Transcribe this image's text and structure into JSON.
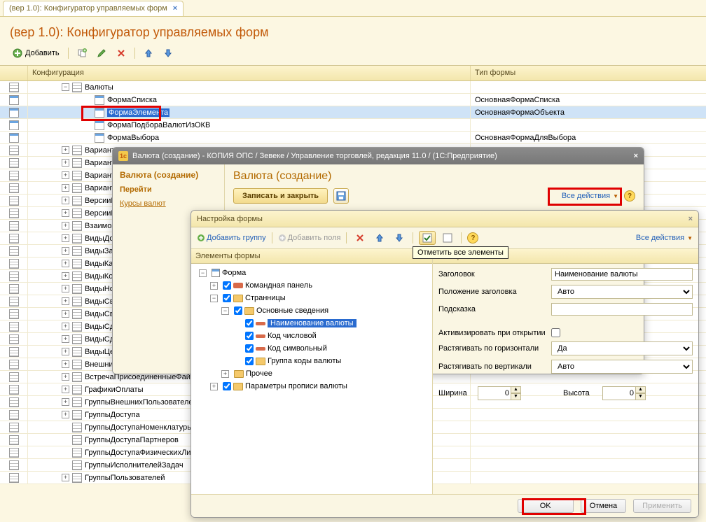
{
  "tab": {
    "title": "(вер 1.0): Конфигуратор управляемых форм"
  },
  "page_title": "(вер 1.0): Конфигуратор управляемых форм",
  "main_toolbar": {
    "add": "Добавить"
  },
  "table": {
    "col_config": "Конфигурация",
    "col_type": "Тип формы",
    "rows": [
      {
        "indent": 48,
        "exp": "−",
        "icon": "grid",
        "label": "Валюты",
        "type": ""
      },
      {
        "indent": 80,
        "icon": "form",
        "label": "ФормаСписка",
        "type": "ОсновнаяФормаСписка"
      },
      {
        "indent": 80,
        "icon": "form",
        "label": "ФормаЭлемента",
        "type": "ОсновнаяФормаОбъекта",
        "selected": true
      },
      {
        "indent": 80,
        "icon": "form",
        "label": "ФормаПодбораВалютИзОКВ",
        "type": ""
      },
      {
        "indent": 80,
        "icon": "form",
        "label": "ФормаВыбора",
        "type": "ОсновнаяФормаДляВыбора"
      },
      {
        "indent": 48,
        "exp": "+",
        "icon": "grid",
        "label": "Варианть",
        "type": ""
      },
      {
        "indent": 48,
        "exp": "+",
        "icon": "grid",
        "label": "Варианть",
        "type": ""
      },
      {
        "indent": 48,
        "exp": "+",
        "icon": "grid",
        "label": "Варианть",
        "type": ""
      },
      {
        "indent": 48,
        "exp": "+",
        "icon": "grid",
        "label": "Варианть",
        "type": ""
      },
      {
        "indent": 48,
        "exp": "+",
        "icon": "grid",
        "label": "ВерсииН",
        "type": ""
      },
      {
        "indent": 48,
        "exp": "+",
        "icon": "grid",
        "label": "ВерсииН",
        "type": ""
      },
      {
        "indent": 48,
        "exp": "+",
        "icon": "grid",
        "label": "Взаимоза",
        "type": ""
      },
      {
        "indent": 48,
        "exp": "+",
        "icon": "grid",
        "label": "ВидыДок",
        "type": ""
      },
      {
        "indent": 48,
        "exp": "+",
        "icon": "grid",
        "label": "ВидыЗап",
        "type": ""
      },
      {
        "indent": 48,
        "exp": "+",
        "icon": "grid",
        "label": "ВидыКарт",
        "type": ""
      },
      {
        "indent": 48,
        "exp": "+",
        "icon": "grid",
        "label": "ВидыКон",
        "type": ""
      },
      {
        "indent": 48,
        "exp": "+",
        "icon": "grid",
        "label": "ВидыНом",
        "type": ""
      },
      {
        "indent": 48,
        "exp": "+",
        "icon": "grid",
        "label": "ВидыСвя",
        "type": ""
      },
      {
        "indent": 48,
        "exp": "+",
        "icon": "grid",
        "label": "ВидыСвя",
        "type": ""
      },
      {
        "indent": 48,
        "exp": "+",
        "icon": "grid",
        "label": "ВидыСде",
        "type": ""
      },
      {
        "indent": 48,
        "exp": "+",
        "icon": "grid",
        "label": "ВидыСде",
        "type": ""
      },
      {
        "indent": 48,
        "exp": "+",
        "icon": "grid",
        "label": "ВидыЦен",
        "type": ""
      },
      {
        "indent": 48,
        "exp": "+",
        "icon": "grid",
        "label": "ВнешниеПользователи",
        "type": ""
      },
      {
        "indent": 48,
        "exp": "+",
        "icon": "grid",
        "label": "ВстречаПрисоединенныеФайл",
        "type": ""
      },
      {
        "indent": 48,
        "exp": "+",
        "icon": "grid",
        "label": "ГрафикиОплаты",
        "type": ""
      },
      {
        "indent": 48,
        "exp": "+",
        "icon": "grid",
        "label": "ГруппыВнешнихПользователей",
        "type": ""
      },
      {
        "indent": 48,
        "exp": "+",
        "icon": "grid",
        "label": "ГруппыДоступа",
        "type": ""
      },
      {
        "indent": 48,
        "icon": "grid",
        "label": "ГруппыДоступаНоменклатуры",
        "type": ""
      },
      {
        "indent": 48,
        "icon": "grid",
        "label": "ГруппыДоступаПартнеров",
        "type": ""
      },
      {
        "indent": 48,
        "icon": "grid",
        "label": "ГруппыДоступаФизическихЛиц",
        "type": ""
      },
      {
        "indent": 48,
        "icon": "grid",
        "label": "ГруппыИсполнителейЗадач",
        "type": ""
      },
      {
        "indent": 48,
        "exp": "+",
        "icon": "grid",
        "label": "ГруппыПользователей",
        "type": ""
      }
    ]
  },
  "modal1": {
    "title": "Валюта (создание) - КОПИЯ ОПС / Зевеке / Управление торговлей, редакция 11.0 /  (1С:Предприятие)",
    "nav_title": "Валюта (создание)",
    "nav_goto": "Перейти",
    "nav_link": "Курсы валют",
    "heading": "Валюта (создание)",
    "save_close": "Записать и закрыть",
    "all_actions": "Все действия"
  },
  "modal2": {
    "title": "Настройка формы",
    "tb_add_group": "Добавить группу",
    "tb_add_fields": "Добавить поля",
    "tb_all_actions": "Все действия",
    "tooltip": "Отметить все элементы",
    "tree_header": "Элементы формы",
    "props_header": "та Формы",
    "tree": [
      {
        "indent": 0,
        "exp": "−",
        "icon": "form",
        "label": "Форма"
      },
      {
        "indent": 16,
        "exp": "+",
        "chk": true,
        "icon": "red",
        "label": "Командная панель"
      },
      {
        "indent": 16,
        "exp": "−",
        "chk": true,
        "icon": "folder",
        "label": "Странницы"
      },
      {
        "indent": 32,
        "exp": "−",
        "chk": true,
        "icon": "folder",
        "label": "Основные сведения"
      },
      {
        "indent": 48,
        "chk": true,
        "icon": "bar",
        "label": "Наименование валюты",
        "sel": true
      },
      {
        "indent": 48,
        "chk": true,
        "icon": "bar",
        "label": "Код числовой"
      },
      {
        "indent": 48,
        "chk": true,
        "icon": "bar",
        "label": "Код символьный"
      },
      {
        "indent": 48,
        "chk": true,
        "icon": "folder",
        "label": "Группа коды валюты"
      },
      {
        "indent": 32,
        "exp": "+",
        "icon": "folder",
        "label": "Прочее"
      },
      {
        "indent": 16,
        "exp": "+",
        "chk": true,
        "icon": "folder",
        "label": "Параметры прописи валюты"
      }
    ],
    "props": {
      "header_label": "Заголовок",
      "header_value": "Наименование валюты",
      "title_pos_label": "Положение заголовка",
      "title_pos_value": "Авто",
      "hint_label": "Подсказка",
      "hint_value": "",
      "activate_label": "Активизировать при открытии",
      "stretch_h_label": "Растягивать по горизонтали",
      "stretch_h_value": "Да",
      "stretch_v_label": "Растягивать по вертикали",
      "stretch_v_value": "Авто",
      "width_label": "Ширина",
      "width_value": "0",
      "height_label": "Высота",
      "height_value": "0"
    },
    "footer": {
      "ok": "OK",
      "cancel": "Отмена",
      "apply": "Применить"
    }
  }
}
